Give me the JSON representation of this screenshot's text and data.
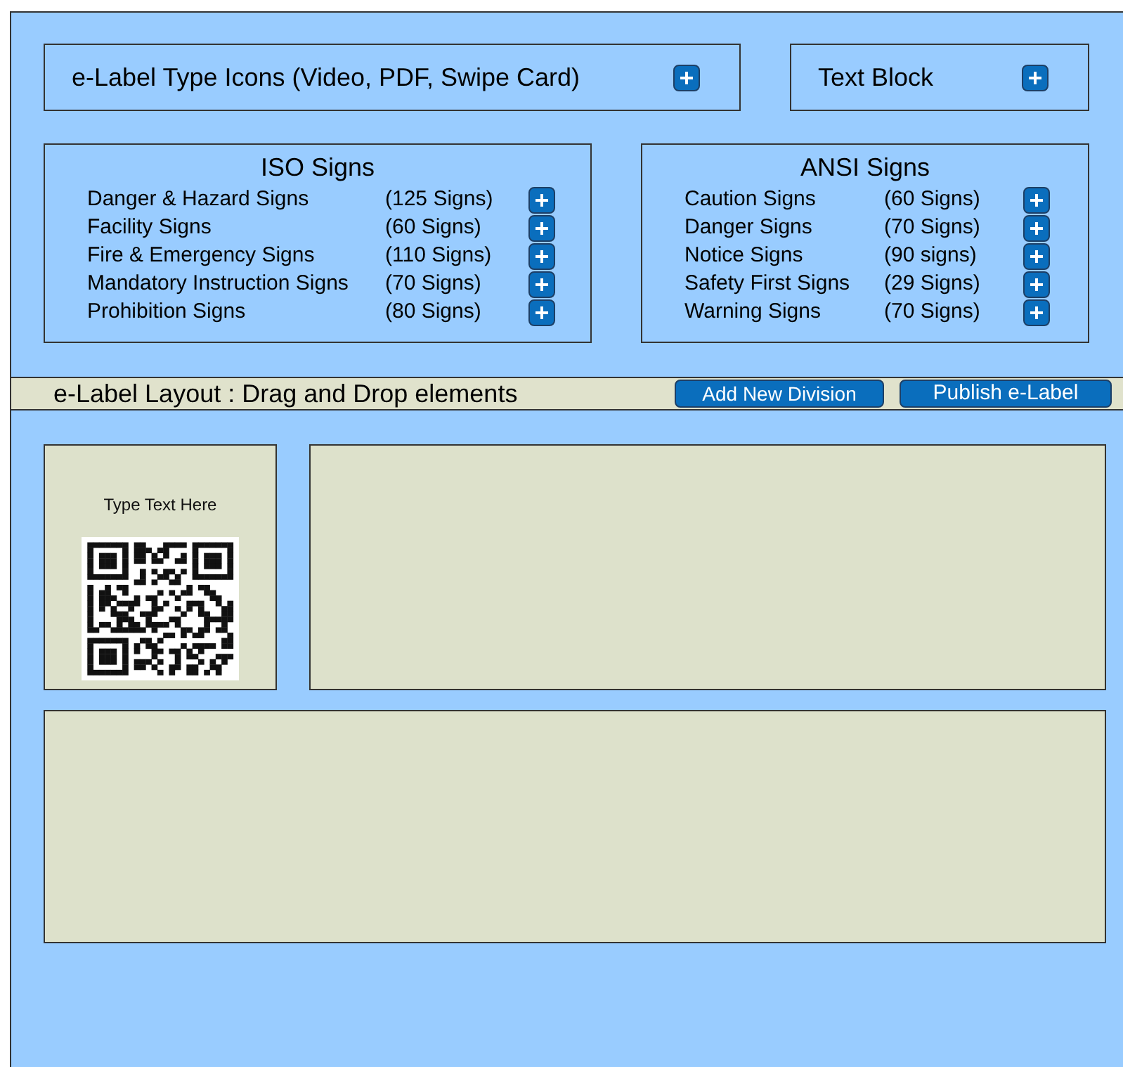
{
  "top_blocks": [
    {
      "label": "e-Label Type Icons (Video, PDF, Swipe Card)"
    },
    {
      "label": "Text Block"
    }
  ],
  "sign_groups": [
    {
      "title": "ISO Signs",
      "items": [
        {
          "name": "Danger & Hazard Signs",
          "count": "(125 Signs)"
        },
        {
          "name": "Facility Signs",
          "count": "(60 Signs)"
        },
        {
          "name": "Fire & Emergency Signs",
          "count": "(110 Signs)"
        },
        {
          "name": "Mandatory Instruction Signs",
          "count": "(70 Signs)"
        },
        {
          "name": "Prohibition Signs",
          "count": "(80 Signs)"
        }
      ]
    },
    {
      "title": "ANSI Signs",
      "items": [
        {
          "name": "Caution Signs",
          "count": "(60 Signs)"
        },
        {
          "name": "Danger Signs",
          "count": "(70 Signs)"
        },
        {
          "name": "Notice Signs",
          "count": "(90 signs)"
        },
        {
          "name": "Safety First Signs",
          "count": "(29 Signs)"
        },
        {
          "name": "Warning Signs",
          "count": "(70 Signs)"
        }
      ]
    }
  ],
  "layout_bar": {
    "title": "e-Label Layout : Drag and Drop elements",
    "buttons": [
      "Add New Division",
      "Publish e-Label"
    ]
  },
  "divisions": [
    {
      "kind": "qr",
      "text": "Type Text Here"
    },
    {
      "kind": "empty"
    },
    {
      "kind": "empty"
    }
  ]
}
